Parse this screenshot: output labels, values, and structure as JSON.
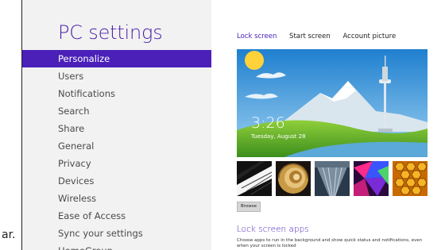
{
  "outside_text": "ar.",
  "sidebar": {
    "title": "PC settings",
    "items": [
      {
        "label": "Personalize"
      },
      {
        "label": "Users"
      },
      {
        "label": "Notifications"
      },
      {
        "label": "Search"
      },
      {
        "label": "Share"
      },
      {
        "label": "General"
      },
      {
        "label": "Privacy"
      },
      {
        "label": "Devices"
      },
      {
        "label": "Wireless"
      },
      {
        "label": "Ease of Access"
      },
      {
        "label": "Sync your settings"
      },
      {
        "label": "HomeGroup"
      }
    ],
    "active_index": 0
  },
  "tabs": [
    {
      "label": "Lock screen"
    },
    {
      "label": "Start screen"
    },
    {
      "label": "Account picture"
    }
  ],
  "preview": {
    "time": "3:26",
    "date": "Tuesday, August 28"
  },
  "browse_label": "Browse",
  "lock_apps": {
    "title": "Lock screen apps",
    "description": "Choose apps to run in the background and show quick status and notifications, even when your screen is locked"
  },
  "colors": {
    "accent": "#4a20b8",
    "sidebar_bg": "#f2f2f2"
  }
}
